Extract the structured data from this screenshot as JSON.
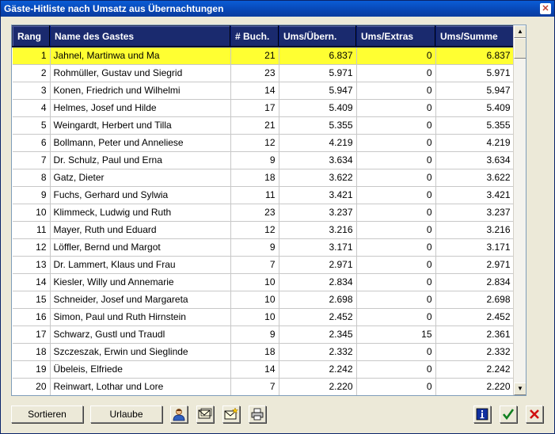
{
  "window": {
    "title": "Gäste-Hitliste nach Umsatz aus Übernachtungen",
    "close_label": "✕"
  },
  "table": {
    "columns": [
      "Rang",
      "Name des Gastes",
      "# Buch.",
      "Ums/Übern.",
      "Ums/Extras",
      "Ums/Summe"
    ],
    "selected_row": 0,
    "rows": [
      {
        "rang": "1",
        "name": "Jahnel, Martinwa und Ma",
        "buch": "21",
        "uebern": "6.837",
        "extras": "0",
        "summe": "6.837"
      },
      {
        "rang": "2",
        "name": "Rohmüller, Gustav und Siegrid",
        "buch": "23",
        "uebern": "5.971",
        "extras": "0",
        "summe": "5.971"
      },
      {
        "rang": "3",
        "name": "Konen, Friedrich und Wilhelmi",
        "buch": "14",
        "uebern": "5.947",
        "extras": "0",
        "summe": "5.947"
      },
      {
        "rang": "4",
        "name": "Helmes, Josef und Hilde",
        "buch": "17",
        "uebern": "5.409",
        "extras": "0",
        "summe": "5.409"
      },
      {
        "rang": "5",
        "name": "Weingardt, Herbert und Tilla",
        "buch": "21",
        "uebern": "5.355",
        "extras": "0",
        "summe": "5.355"
      },
      {
        "rang": "6",
        "name": "Bollmann, Peter und Anneliese",
        "buch": "12",
        "uebern": "4.219",
        "extras": "0",
        "summe": "4.219"
      },
      {
        "rang": "7",
        "name": "Dr. Schulz, Paul und Erna",
        "buch": "9",
        "uebern": "3.634",
        "extras": "0",
        "summe": "3.634"
      },
      {
        "rang": "8",
        "name": "Gatz, Dieter",
        "buch": "18",
        "uebern": "3.622",
        "extras": "0",
        "summe": "3.622"
      },
      {
        "rang": "9",
        "name": "Fuchs, Gerhard und Sylwia",
        "buch": "11",
        "uebern": "3.421",
        "extras": "0",
        "summe": "3.421"
      },
      {
        "rang": "10",
        "name": "Klimmeck, Ludwig und Ruth",
        "buch": "23",
        "uebern": "3.237",
        "extras": "0",
        "summe": "3.237"
      },
      {
        "rang": "11",
        "name": "Mayer, Ruth und Eduard",
        "buch": "12",
        "uebern": "3.216",
        "extras": "0",
        "summe": "3.216"
      },
      {
        "rang": "12",
        "name": "Löffler, Bernd und Margot",
        "buch": "9",
        "uebern": "3.171",
        "extras": "0",
        "summe": "3.171"
      },
      {
        "rang": "13",
        "name": "Dr. Lammert, Klaus und Frau",
        "buch": "7",
        "uebern": "2.971",
        "extras": "0",
        "summe": "2.971"
      },
      {
        "rang": "14",
        "name": "Kiesler, Willy und Annemarie",
        "buch": "10",
        "uebern": "2.834",
        "extras": "0",
        "summe": "2.834"
      },
      {
        "rang": "15",
        "name": "Schneider, Josef und Margareta",
        "buch": "10",
        "uebern": "2.698",
        "extras": "0",
        "summe": "2.698"
      },
      {
        "rang": "16",
        "name": "Simon, Paul und Ruth Hirnstein",
        "buch": "10",
        "uebern": "2.452",
        "extras": "0",
        "summe": "2.452"
      },
      {
        "rang": "17",
        "name": "Schwarz, Gustl und Traudl",
        "buch": "9",
        "uebern": "2.345",
        "extras": "15",
        "summe": "2.361"
      },
      {
        "rang": "18",
        "name": "Szczeszak, Erwin und Sieglinde",
        "buch": "18",
        "uebern": "2.332",
        "extras": "0",
        "summe": "2.332"
      },
      {
        "rang": "19",
        "name": "Übeleis, Elfriede",
        "buch": "14",
        "uebern": "2.242",
        "extras": "0",
        "summe": "2.242"
      },
      {
        "rang": "20",
        "name": "Reinwart, Lothar und Lore",
        "buch": "7",
        "uebern": "2.220",
        "extras": "0",
        "summe": "2.220"
      }
    ]
  },
  "scrollbar": {
    "up_arrow": "▲",
    "down_arrow": "▼"
  },
  "buttons": {
    "sort_label": "Sortieren",
    "vacation_label": "Urlaube"
  },
  "icons": {
    "guest": "person-icon",
    "mail": "envelope-icon",
    "mail_new": "envelope-star-icon",
    "print": "printer-icon",
    "info": "info-icon",
    "ok": "checkmark-icon",
    "cancel": "x-icon"
  },
  "colors": {
    "header_bg": "#1a2a6e",
    "selected_row": "#ffff32",
    "title_bar": "#0a5cd6"
  }
}
